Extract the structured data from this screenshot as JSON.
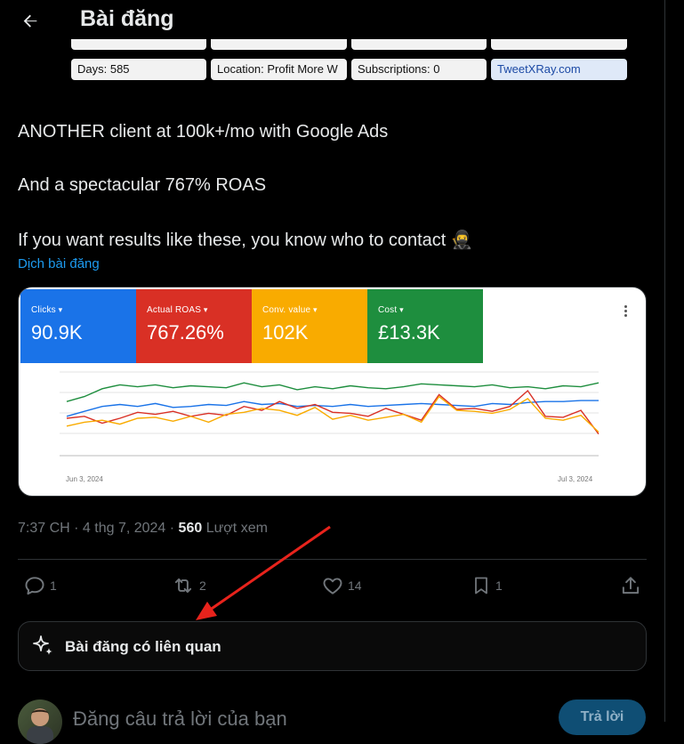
{
  "header": {
    "title": "Bài đăng",
    "back_icon": "arrow-left-icon"
  },
  "tweetxray": {
    "days": "Days: 585",
    "location": "Location: Profit More W",
    "subscriptions": "Subscriptions: 0",
    "link": "TweetXRay.com"
  },
  "tweet": {
    "line1": "ANOTHER client at 100k+/mo with Google Ads",
    "line2": "And a spectacular 767% ROAS",
    "line3": "If you want results like these, you know who to contact 🥷",
    "translate": "Dịch bài đăng"
  },
  "media": {
    "metrics": [
      {
        "label": "Clicks",
        "value": "90.9K",
        "color": "#1a73e8"
      },
      {
        "label": "Actual ROAS",
        "value": "767.26%",
        "color": "#d93025"
      },
      {
        "label": "Conv. value",
        "value": "102K",
        "color": "#f9ab00"
      },
      {
        "label": "Cost",
        "value": "£13.3K",
        "color": "#1e8e3e"
      }
    ],
    "x_start": "Jun 3, 2024",
    "x_end": "Jul 3, 2024"
  },
  "chart_data": {
    "type": "line",
    "x": [
      "Jun 3, 2024",
      "Jul 3, 2024"
    ],
    "grid": true,
    "series": [
      {
        "name": "Cost",
        "color": "#1e8e3e",
        "values": [
          55,
          60,
          68,
          72,
          70,
          72,
          69,
          71,
          70,
          69,
          74,
          70,
          72,
          67,
          70,
          68,
          71,
          69,
          68,
          70,
          73,
          72,
          71,
          70,
          72,
          69,
          70,
          68,
          71,
          70,
          74
        ]
      },
      {
        "name": "Clicks",
        "color": "#1a73e8",
        "values": [
          40,
          45,
          50,
          52,
          50,
          53,
          49,
          50,
          52,
          51,
          55,
          52,
          53,
          50,
          51,
          50,
          52,
          50,
          51,
          52,
          53,
          52,
          51,
          50,
          53,
          52,
          54,
          55,
          55,
          56,
          56
        ]
      },
      {
        "name": "Actual ROAS",
        "color": "#d93025",
        "values": [
          38,
          40,
          33,
          38,
          44,
          42,
          45,
          40,
          43,
          41,
          50,
          46,
          55,
          48,
          52,
          44,
          43,
          40,
          48,
          42,
          36,
          62,
          47,
          48,
          45,
          50,
          66,
          40,
          39,
          46,
          22
        ]
      },
      {
        "name": "Conv. value",
        "color": "#f9ab00",
        "values": [
          30,
          34,
          36,
          32,
          38,
          39,
          35,
          40,
          34,
          42,
          44,
          48,
          46,
          41,
          49,
          37,
          41,
          36,
          39,
          42,
          34,
          60,
          46,
          45,
          43,
          47,
          58,
          38,
          36,
          41,
          24
        ]
      }
    ]
  },
  "meta": {
    "time": "7:37 CH · 4 thg 7, 2024 · ",
    "views": "560",
    "views_label": " Lượt xem"
  },
  "actions": {
    "replies": "1",
    "reposts": "2",
    "likes": "14",
    "bookmarks": "1"
  },
  "related": {
    "label": "Bài đăng có liên quan"
  },
  "reply": {
    "placeholder": "Đăng câu trả lời của bạn",
    "button": "Trả lời"
  }
}
